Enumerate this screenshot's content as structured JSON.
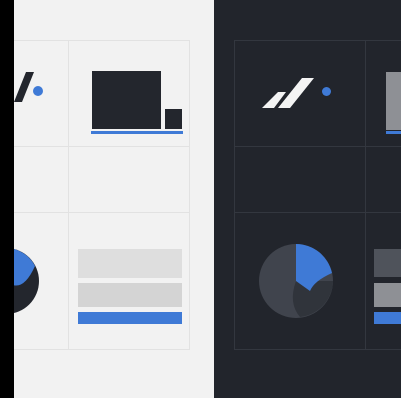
{
  "colors": {
    "frame": "#000000",
    "light_background": "#f2f2f2",
    "light_grid": "#e2e2e2",
    "light_ink": "#23262d",
    "light_placeholder": "#dedede",
    "light_placeholder_alt": "#d4d4d4",
    "dark_background": "#22252c",
    "dark_grid": "#33373f",
    "dark_ink": "#f4f4f4",
    "dark_slice": "#40444d",
    "dark_placeholder": "#4f535b",
    "dark_placeholder_alt": "#8e9095",
    "accent": "#3f7ad6"
  },
  "panels": [
    {
      "theme": "light",
      "tiles": [
        "logo-mark",
        "devices",
        "pie-chart",
        "stacked-bars"
      ]
    },
    {
      "theme": "dark",
      "tiles": [
        "logo-mark",
        "devices",
        "pie-chart",
        "stacked-bars"
      ]
    }
  ],
  "icons": [
    "slash-logo-icon",
    "dot-icon",
    "monitor-icon",
    "phone-icon",
    "pie-chart-icon",
    "placeholder-bar-icon"
  ]
}
